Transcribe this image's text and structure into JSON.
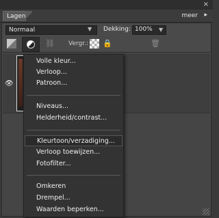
{
  "window": {
    "close_glyph": "×"
  },
  "tab": {
    "label": "Lagen"
  },
  "panel_menu": {
    "label": "meer",
    "icon": "double-arrow-icon"
  },
  "blend_mode": {
    "value": "Normaal"
  },
  "opacity": {
    "label": "Dekking:",
    "value": "100%"
  },
  "toolbar": {
    "lock_label": "Vergr.:"
  },
  "context_menu": {
    "groups": [
      [
        "Volle kleur...",
        "Verloop...",
        "Patroon..."
      ],
      [
        "Niveaus...",
        "Helderheid/contrast..."
      ],
      [
        "Kleurtoon/verzadiging...",
        "Verloop toewijzen...",
        "Fotofilter..."
      ],
      [
        "Omkeren",
        "Drempel...",
        "Waarden beperken..."
      ]
    ],
    "highlighted": "Kleurtoon/verzadiging..."
  }
}
